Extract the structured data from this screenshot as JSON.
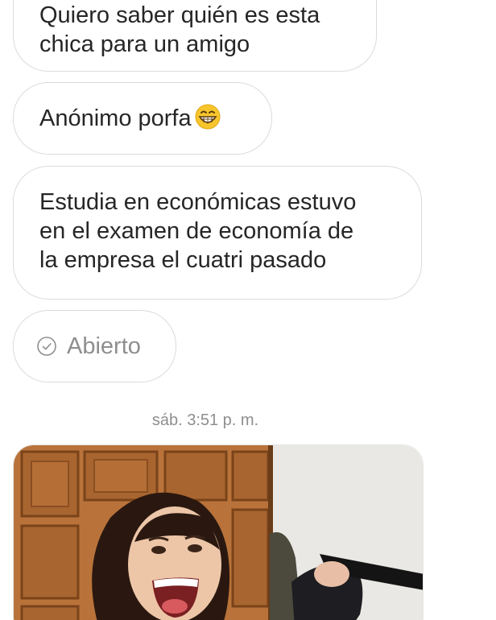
{
  "messages": [
    {
      "lines": [
        "Quiero saber quién es esta",
        "chica para un amigo"
      ]
    },
    {
      "lines": [
        "Anónimo porfa"
      ],
      "emoji": "grinning-face-emoji"
    },
    {
      "lines": [
        "Estudia en económicas estuvo",
        "en el examen de economía de",
        "la empresa el cuatri pasado"
      ]
    }
  ],
  "status": {
    "label": "Abierto",
    "icon": "check-circle-icon"
  },
  "timestamp": "sáb. 3:51 p. m.",
  "colors": {
    "bubble_border": "#dbdbdb",
    "text": "#262626",
    "muted": "#8e8e8e"
  }
}
